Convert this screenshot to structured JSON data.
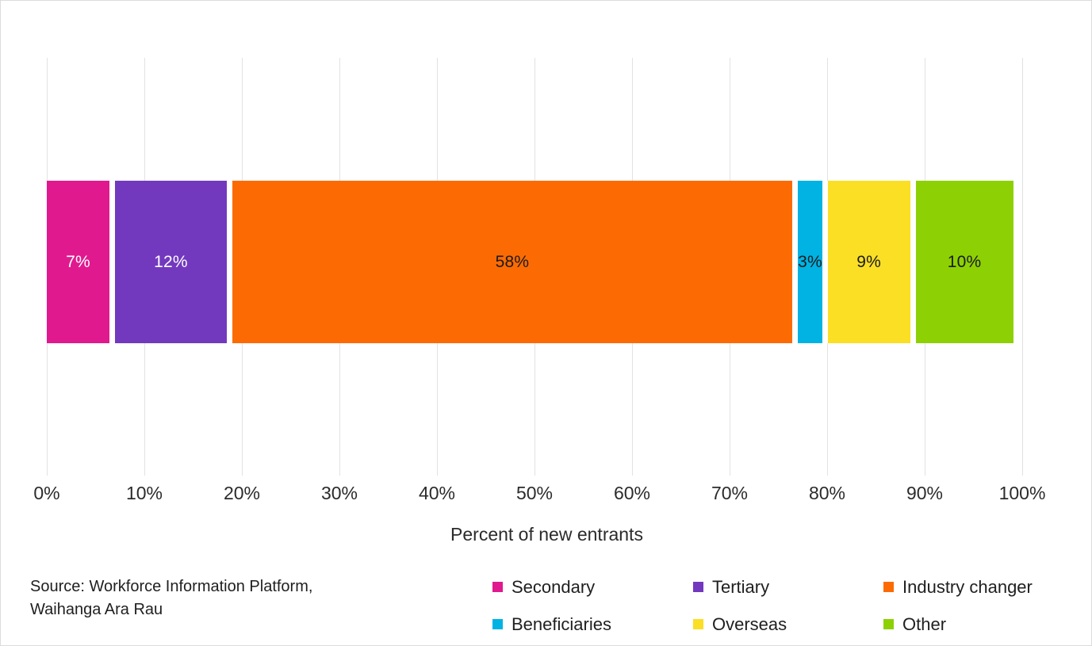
{
  "chart_data": {
    "type": "bar",
    "orientation": "horizontal",
    "stacked": true,
    "title": "",
    "subtitle": "",
    "xlabel": "Percent of new entrants",
    "ylabel": "",
    "xlim": [
      0,
      100
    ],
    "xticks": [
      "0%",
      "10%",
      "20%",
      "30%",
      "40%",
      "50%",
      "60%",
      "70%",
      "80%",
      "90%",
      "100%"
    ],
    "xtick_values": [
      0,
      10,
      20,
      30,
      40,
      50,
      60,
      70,
      80,
      90,
      100
    ],
    "grid": "vertical-only",
    "legend_position": "bottom",
    "categories": [
      "New entrants"
    ],
    "series": [
      {
        "name": "Secondary",
        "values": [
          7
        ],
        "label": "7%",
        "color": "#E01A8E",
        "label_color": "#ffffff"
      },
      {
        "name": "Tertiary",
        "values": [
          12
        ],
        "label": "12%",
        "color": "#7239BF",
        "label_color": "#ffffff"
      },
      {
        "name": "Industry changer",
        "values": [
          58
        ],
        "label": "58%",
        "color": "#FC6B03",
        "label_color": "#1a1a1a"
      },
      {
        "name": "Beneficiaries",
        "values": [
          3
        ],
        "label": "3%",
        "color": "#00B3E3",
        "label_color": "#1a1a1a"
      },
      {
        "name": "Overseas",
        "values": [
          9
        ],
        "label": "9%",
        "color": "#FADF25",
        "label_color": "#1a1a1a"
      },
      {
        "name": "Other",
        "values": [
          10
        ],
        "label": "10%",
        "color": "#8DD104",
        "label_color": "#1a1a1a"
      }
    ],
    "annotations": {
      "source": "Source: Workforce Information Platform, Waihanga Ara Rau"
    }
  },
  "footer": {
    "source_line_1": "Source: Workforce Information Platform,",
    "source_line_2": "Waihanga Ara Rau"
  },
  "colors": {
    "gridline": "#e2e2e2",
    "border": "#dcdcdc",
    "background": "#ffffff",
    "axis_text": "#2b2b2b"
  }
}
